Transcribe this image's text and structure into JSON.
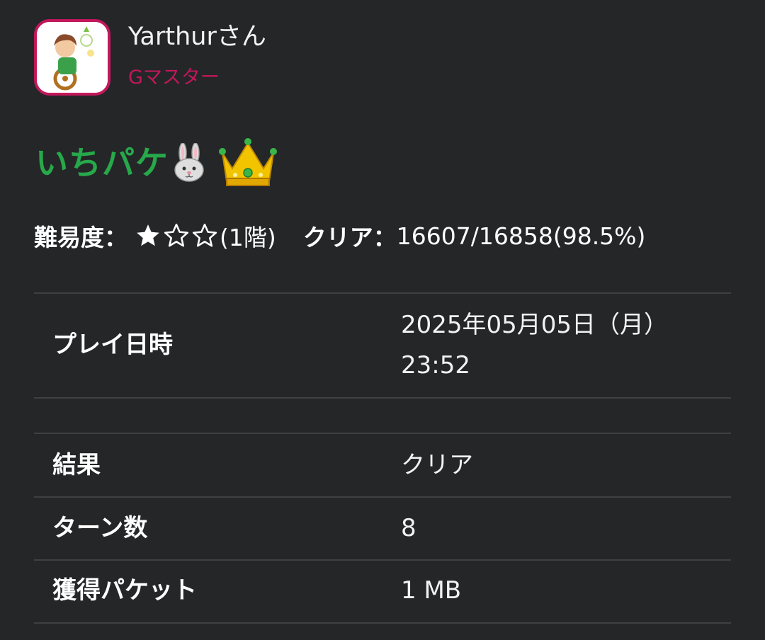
{
  "user": {
    "name": "Yarthurさん",
    "rank": "Gマスター",
    "avatar_icon": "game-character-avatar-icon",
    "rank_color": "#c2185b"
  },
  "stage": {
    "title": "いちパケ",
    "title_color": "#27a84a",
    "icons": [
      "rabbit-face-icon",
      "crown-icon"
    ]
  },
  "difficulty": {
    "label": "難易度：",
    "stars_filled": 1,
    "stars_total": 3,
    "floor": "(1階)"
  },
  "clear": {
    "label": "クリア：",
    "value": "16607/16858(98.5%)"
  },
  "details": {
    "play_datetime": {
      "label": "プレイ日時",
      "date": "2025年05月05日（月）",
      "time": "23:52"
    },
    "result": {
      "label": "結果",
      "value": "クリア"
    },
    "turns": {
      "label": "ターン数",
      "value": "8"
    },
    "packets": {
      "label": "獲得パケット",
      "value": "1 MB"
    }
  },
  "theme": {
    "background": "#242628",
    "divider": "#3e4143"
  }
}
